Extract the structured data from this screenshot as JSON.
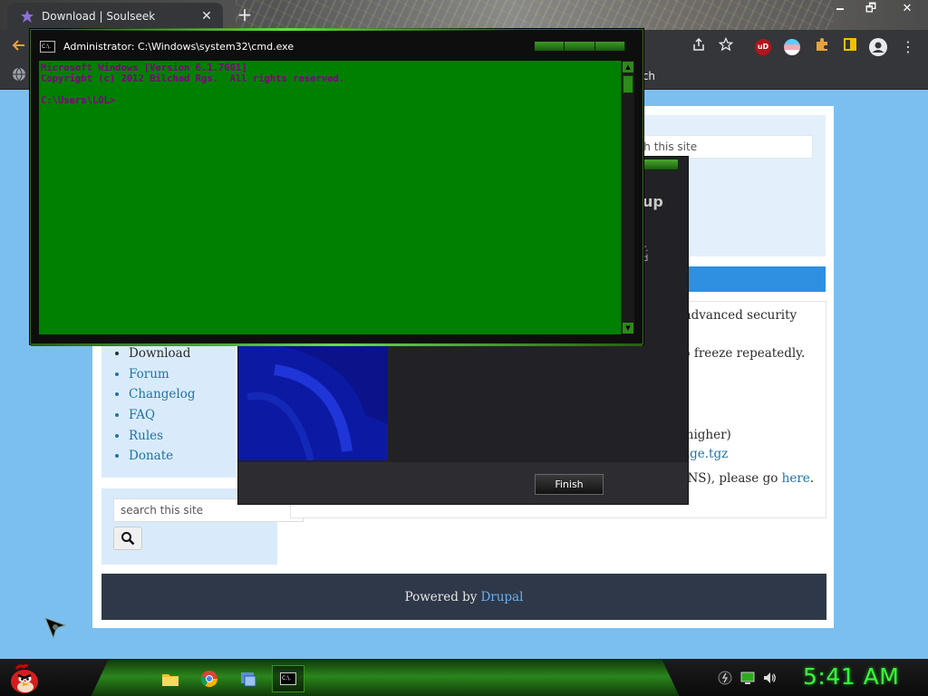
{
  "browser": {
    "tab_title": "Download | Soulseek",
    "tab_close": "✕",
    "new_tab": "+",
    "window_controls": {
      "minimize": "🗕",
      "maximize": "🗗",
      "close": "✕"
    },
    "bookmark_fragment": ".ch",
    "extension_ublock_label": "uD"
  },
  "website": {
    "nav_items": [
      "Download",
      "Forum",
      "Changelog",
      "FAQ",
      "Rules",
      "Donate"
    ],
    "nav_current": "Download",
    "search_placeholder": "search this site",
    "right_search_placeholder": "rch this site",
    "content": {
      "line1": "i advanced security",
      "line2": "to freeze repeatedly.",
      "line3": "r higher)",
      "line4_link": "imge.tgz",
      "line5_prefix": "k NS), please go",
      "line5_link": "here",
      "line5_suffix": "."
    },
    "footer": {
      "powered_by": "Powered by",
      "drupal": "Drupal"
    }
  },
  "setup_dialog": {
    "heading_fragment": "up",
    "small_line1": "r.",
    "small_line2": "d",
    "finish_label": "Finish"
  },
  "cmd": {
    "icon_text": "C:\\.",
    "title": "Administrator: C:\\Windows\\system32\\cmd.exe",
    "lines": [
      "Microsoft Windows [Version 6.1.7601]",
      "Copyright (c) 2012 Bilchad Rgs.  All rights reserved.",
      "",
      "C:\\Users\\LOL>"
    ],
    "console_bg": "#008000",
    "console_fg": "#800080"
  },
  "taskbar": {
    "clock": "5:41 AM",
    "clock_color": "#35ff3a",
    "cmd_icon_text": "C:\\."
  }
}
